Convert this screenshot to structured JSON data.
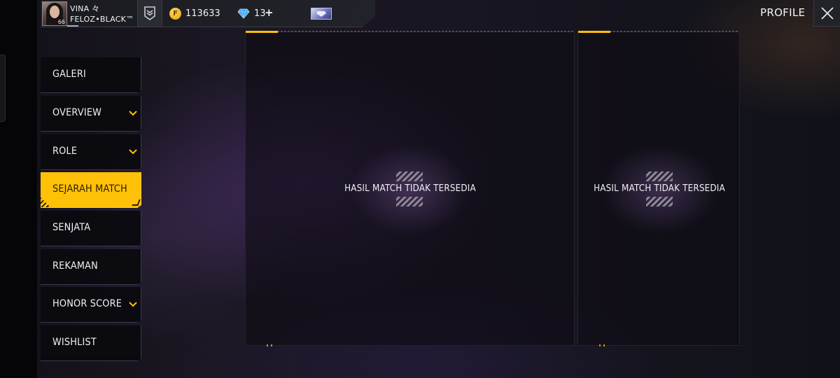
{
  "player": {
    "name": "VINA 々",
    "guild": "FELOZ•BLACK™",
    "level": "66"
  },
  "currency": {
    "coin_symbol": "F",
    "coins": "113633",
    "diamonds": "13",
    "plus": "+"
  },
  "header": {
    "title": "PROFILE"
  },
  "sidebar": {
    "items": [
      {
        "label": "GALERI",
        "has_chevron": false
      },
      {
        "label": "OVERVIEW",
        "has_chevron": true
      },
      {
        "label": "ROLE",
        "has_chevron": true
      },
      {
        "label": "SEJARAH MATCH",
        "has_chevron": false,
        "active": true
      },
      {
        "label": "SENJATA",
        "has_chevron": false
      },
      {
        "label": "REKAMAN",
        "has_chevron": false
      },
      {
        "label": "HONOR SCORE",
        "has_chevron": true
      },
      {
        "label": "WISHLIST",
        "has_chevron": false
      }
    ]
  },
  "panels": [
    {
      "message": "HASIL MATCH TIDAK TERSEDIA"
    },
    {
      "message": "HASIL MATCH TIDAK TERSEDIA"
    }
  ],
  "colors": {
    "accent": "#ffc107",
    "active_text": "#2a1d00",
    "diamond": "#3fa9ff"
  },
  "icons": {
    "rank": "rank-chevron-badge-icon",
    "coin": "gold-coin-icon",
    "diamond": "diamond-icon",
    "pass": "elite-pass-icon",
    "close": "close-x-icon",
    "chevron": "chevron-down-icon",
    "empty": "empty-result-stripes-icon"
  }
}
